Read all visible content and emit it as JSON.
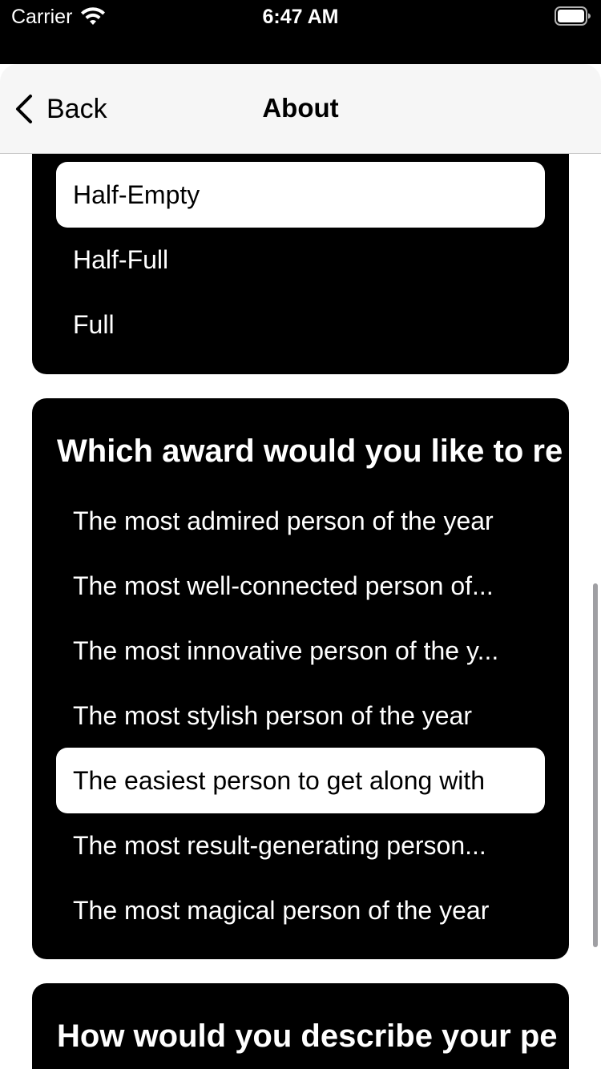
{
  "status_bar": {
    "carrier": "Carrier",
    "time": "6:47 AM",
    "wifi_icon": "wifi-icon",
    "battery_icon": "battery-icon"
  },
  "nav": {
    "back_label": "Back",
    "title": "About",
    "back_icon": "chevron-left-icon"
  },
  "cards": [
    {
      "options": [
        {
          "label": "Half-Empty",
          "selected": true
        },
        {
          "label": "Half-Full",
          "selected": false
        },
        {
          "label": "Full",
          "selected": false
        }
      ]
    },
    {
      "question": "Which award would you like to re",
      "options": [
        {
          "label": "The most admired person of the year",
          "selected": false
        },
        {
          "label": "The most well-connected person of...",
          "selected": false
        },
        {
          "label": "The most innovative person of the y...",
          "selected": false
        },
        {
          "label": "The most stylish person of the year",
          "selected": false
        },
        {
          "label": "The easiest person to get along with",
          "selected": true
        },
        {
          "label": "The most result-generating person...",
          "selected": false
        },
        {
          "label": "The most magical person of the year",
          "selected": false
        }
      ]
    },
    {
      "question": "How would you describe your pe"
    }
  ],
  "colors": {
    "card_background": "#000000",
    "selected_option_background": "#ffffff",
    "nav_background": "#f6f6f6"
  }
}
